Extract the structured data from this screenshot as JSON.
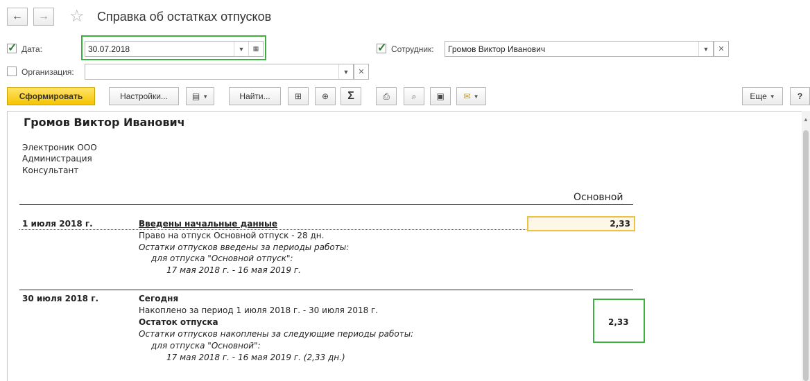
{
  "header": {
    "back_icon": "arrow-left-icon",
    "forward_icon": "arrow-right-icon",
    "back_glyph": "←",
    "forward_glyph": "→",
    "star_glyph": "☆",
    "title": "Справка об остатках отпусков"
  },
  "filters": {
    "date": {
      "checked": true,
      "label": "Дата:",
      "value": "30.07.2018"
    },
    "employee": {
      "checked": true,
      "label": "Сотрудник:",
      "value": "Громов Виктор Иванович"
    },
    "organization": {
      "checked": false,
      "label": "Организация:",
      "value": ""
    }
  },
  "toolbar": {
    "generate": "Сформировать",
    "settings": "Настройки...",
    "find": "Найти...",
    "sum_glyph": "Σ",
    "more": "Еще",
    "help": "?"
  },
  "report": {
    "employee_name": "Громов Виктор Иванович",
    "org_lines": [
      "Электроник ООО",
      "Администрация",
      "Консультант"
    ],
    "column_header": "Основной",
    "entry1": {
      "date": "1 июля 2018 г.",
      "title": "Введены начальные данные",
      "value": "2,33",
      "lines": [
        "Право на отпуск Основной отпуск - 28 дн.",
        "Остатки отпусков введены за периоды работы:",
        "для отпуска \"Основной отпуск\":",
        "17 мая 2018 г. - 16 мая 2019 г."
      ]
    },
    "entry2": {
      "date": "30 июля 2018 г.",
      "title": "Сегодня",
      "accrued": "Накоплено за период 1 июля 2018 г. - 30 июля 2018 г.",
      "balance_label": "Остаток отпуска",
      "value": "2,33",
      "lines": [
        "Остатки отпусков накоплены за следующие периоды работы:",
        "для отпуска \"Основной\":",
        "17 мая 2018 г. - 16 мая 2019 г. (2,33 дн.)"
      ]
    }
  },
  "colors": {
    "highlight_green": "#3cb03c",
    "primary_button": "#f5c400",
    "selected_cell_border": "#f0c040"
  }
}
